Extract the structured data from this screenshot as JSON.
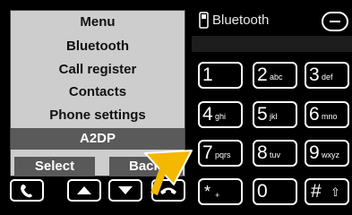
{
  "menu": {
    "title": "Menu",
    "items": [
      "Bluetooth",
      "Call register",
      "Contacts",
      "Phone settings",
      "A2DP"
    ],
    "selected_index": 4
  },
  "softkeys": {
    "left": "Select",
    "right": "Back"
  },
  "phone": {
    "header_label": "Bluetooth"
  },
  "keypad": [
    {
      "digit": "1",
      "letters": ""
    },
    {
      "digit": "2",
      "letters": "abc"
    },
    {
      "digit": "3",
      "letters": "def"
    },
    {
      "digit": "4",
      "letters": "ghi"
    },
    {
      "digit": "5",
      "letters": "jkl"
    },
    {
      "digit": "6",
      "letters": "mno"
    },
    {
      "digit": "7",
      "letters": "pqrs"
    },
    {
      "digit": "8",
      "letters": "tuv"
    },
    {
      "digit": "9",
      "letters": "wxyz"
    },
    {
      "digit": "*",
      "letters": "+"
    },
    {
      "digit": "0",
      "letters": ""
    },
    {
      "digit": "#",
      "letters": "⇧"
    }
  ],
  "colors": {
    "accent_arrow": "#f5b800",
    "lcd_bg": "#cdcdcd",
    "selection": "#5a5a5a"
  },
  "icons": [
    "call-icon",
    "up-arrow-icon",
    "down-arrow-icon",
    "end-call-icon",
    "phone-handset-icon",
    "minus-icon"
  ]
}
